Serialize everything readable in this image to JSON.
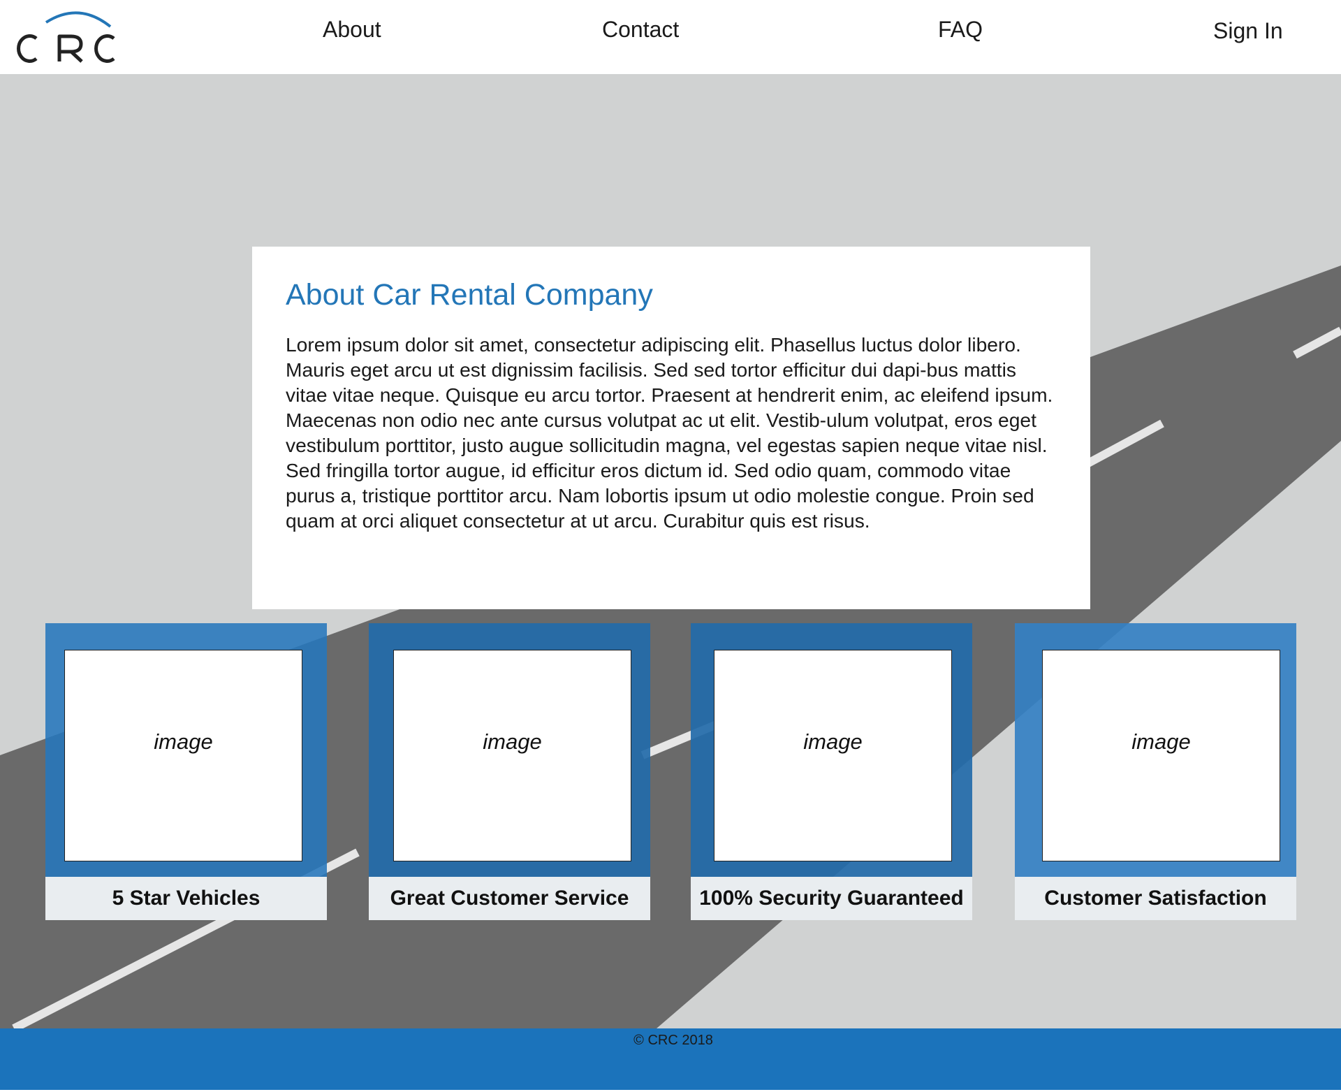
{
  "header": {
    "logo_text": "CRC",
    "nav": {
      "about": "About",
      "contact": "Contact",
      "faq": "FAQ",
      "sign_in": "Sign In"
    }
  },
  "about": {
    "title": "About Car Rental Company",
    "body": "Lorem ipsum dolor sit amet, consectetur adipiscing elit. Phasellus luctus dolor libero. Mauris eget arcu ut est dignissim facilisis. Sed sed tortor efficitur dui dapi-bus mattis vitae vitae neque. Quisque eu arcu tortor. Praesent at hendrerit enim, ac eleifend ipsum. Maecenas non odio nec ante cursus volutpat ac ut elit. Vestib-ulum volutpat, eros eget vestibulum porttitor, justo augue sollicitudin magna, vel egestas sapien neque vitae nisl. Sed fringilla tortor augue, id efficitur eros dictum id. Sed odio quam, commodo vitae purus a, tristique porttitor arcu. Nam lobortis ipsum ut odio molestie congue. Proin sed quam at orci aliquet consectetur at ut arcu. Curabitur quis est risus."
  },
  "features": [
    {
      "image_label": "image",
      "caption": "5 Star Vehicles"
    },
    {
      "image_label": "image",
      "caption": "Great Customer Service"
    },
    {
      "image_label": "image",
      "caption": "100% Security Guaranteed"
    },
    {
      "image_label": "image",
      "caption": "Customer Satisfaction"
    }
  ],
  "footer": {
    "copyright": "© CRC 2018"
  },
  "colors": {
    "brand_blue": "#1b73bb",
    "title_blue": "#2376b7",
    "background_gray": "#d0d2d2",
    "road_gray": "#6a6a6a"
  }
}
